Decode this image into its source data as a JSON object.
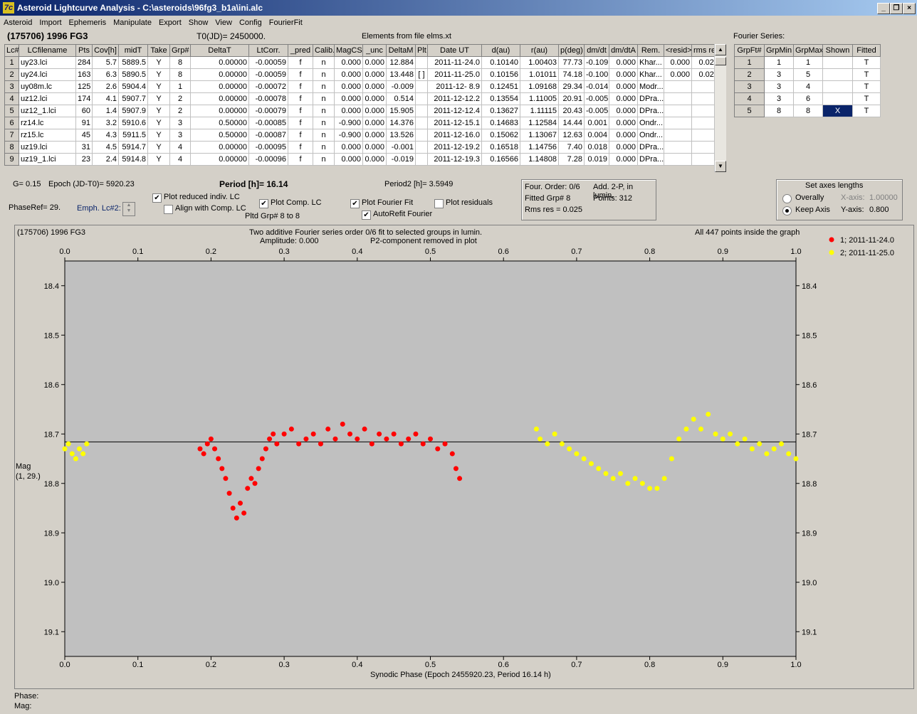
{
  "window": {
    "title": "Asteroid Lightcurve Analysis - C:\\asteroids\\96fg3_b1a\\ini.alc",
    "app_icon": "7c",
    "controls": [
      "_",
      "❐",
      "×"
    ]
  },
  "menu": [
    "Asteroid",
    "Import",
    "Ephemeris",
    "Manipulate",
    "Export",
    "Show",
    "View",
    "Config",
    "FourierFit"
  ],
  "header": {
    "asteroid": "(175706) 1996 FG3",
    "t0": "T0(JD)= 2450000.",
    "elements": "Elements from file elms.xt"
  },
  "lc_table": {
    "columns": [
      "Lc#",
      "LCfilename",
      "Pts",
      "Cov[h]",
      "midT",
      "Take",
      "Grp#",
      "DeltaT",
      "LtCorr.",
      "_pred",
      "Calib.",
      "MagCS",
      "_unc",
      "DeltaM",
      "Plt",
      "Date UT",
      "d(au)",
      "r(au)",
      "p(deg)",
      "dm/dt",
      "dm/dtA",
      "Rem.",
      "<resid>",
      "rms res"
    ],
    "rows": [
      [
        "1",
        "uy23.lci",
        "284",
        "5.7",
        "5889.5",
        "Y",
        "8",
        "0.00000",
        "-0.00059",
        "f",
        "n",
        "0.000",
        "0.000",
        "12.884",
        "",
        "2011-11-24.0",
        "0.10140",
        "1.00403",
        "77.73",
        "-0.109",
        "0.000",
        "Khar...",
        "0.000",
        "0.024"
      ],
      [
        "2",
        "uy24.lci",
        "163",
        "6.3",
        "5890.5",
        "Y",
        "8",
        "0.00000",
        "-0.00059",
        "f",
        "n",
        "0.000",
        "0.000",
        "13.448",
        "[ ]",
        "2011-11-25.0",
        "0.10156",
        "1.01011",
        "74.18",
        "-0.100",
        "0.000",
        "Khar...",
        "0.000",
        "0.026"
      ],
      [
        "3",
        "uy08m.lc",
        "125",
        "2.6",
        "5904.4",
        "Y",
        "1",
        "0.00000",
        "-0.00072",
        "f",
        "n",
        "0.000",
        "0.000",
        "-0.009",
        "",
        "2011-12- 8.9",
        "0.12451",
        "1.09168",
        "29.34",
        "-0.014",
        "0.000",
        "Modr...",
        "",
        ""
      ],
      [
        "4",
        "uz12.lci",
        "174",
        "4.1",
        "5907.7",
        "Y",
        "2",
        "0.00000",
        "-0.00078",
        "f",
        "n",
        "0.000",
        "0.000",
        "0.514",
        "",
        "2011-12-12.2",
        "0.13554",
        "1.11005",
        "20.91",
        "-0.005",
        "0.000",
        "DPra...",
        "",
        ""
      ],
      [
        "5",
        "uz12_1.lci",
        "60",
        "1.4",
        "5907.9",
        "Y",
        "2",
        "0.00000",
        "-0.00079",
        "f",
        "n",
        "0.000",
        "0.000",
        "15.905",
        "",
        "2011-12-12.4",
        "0.13627",
        "1.11115",
        "20.43",
        "-0.005",
        "0.000",
        "DPra...",
        "",
        ""
      ],
      [
        "6",
        "rz14.lc",
        "91",
        "3.2",
        "5910.6",
        "Y",
        "3",
        "0.50000",
        "-0.00085",
        "f",
        "n",
        "-0.900",
        "0.000",
        "14.376",
        "",
        "2011-12-15.1",
        "0.14683",
        "1.12584",
        "14.44",
        "0.001",
        "0.000",
        "Ondr...",
        "",
        ""
      ],
      [
        "7",
        "rz15.lc",
        "45",
        "4.3",
        "5911.5",
        "Y",
        "3",
        "0.50000",
        "-0.00087",
        "f",
        "n",
        "-0.900",
        "0.000",
        "13.526",
        "",
        "2011-12-16.0",
        "0.15062",
        "1.13067",
        "12.63",
        "0.004",
        "0.000",
        "Ondr...",
        "",
        ""
      ],
      [
        "8",
        "uz19.lci",
        "31",
        "4.5",
        "5914.7",
        "Y",
        "4",
        "0.00000",
        "-0.00095",
        "f",
        "n",
        "0.000",
        "0.000",
        "-0.001",
        "",
        "2011-12-19.2",
        "0.16518",
        "1.14756",
        "7.40",
        "0.018",
        "0.000",
        "DPra...",
        "",
        ""
      ],
      [
        "9",
        "uz19_1.lci",
        "23",
        "2.4",
        "5914.8",
        "Y",
        "4",
        "0.00000",
        "-0.00096",
        "f",
        "n",
        "0.000",
        "0.000",
        "-0.019",
        "",
        "2011-12-19.3",
        "0.16566",
        "1.14808",
        "7.28",
        "0.019",
        "0.000",
        "DPra...",
        "",
        ""
      ]
    ]
  },
  "fourier_series": {
    "label": "Fourier Series:",
    "columns": [
      "GrpFt#",
      "GrpMin",
      "GrpMax",
      "Shown",
      "Fitted"
    ],
    "rows": [
      [
        "1",
        "1",
        "1",
        "",
        "T"
      ],
      [
        "2",
        "3",
        "5",
        "",
        "T"
      ],
      [
        "3",
        "3",
        "4",
        "",
        "T"
      ],
      [
        "4",
        "3",
        "6",
        "",
        "T"
      ],
      [
        "5",
        "8",
        "8",
        "X",
        "T"
      ]
    ]
  },
  "controls": {
    "g": "G= 0.15",
    "epoch": "Epoch (JD-T0)= 5920.23",
    "period": "Period [h]= 16.14",
    "period2": "Period2 [h]= 3.5949",
    "phaseref": "PhaseRef= 29.",
    "emph": "Emph. Lc#2:",
    "plot_reduced": "Plot reduced indiv. LC",
    "align": "Align with Comp. LC",
    "plot_comp": "Plot Comp. LC",
    "pltd_grp": "Pltd Grp#  8   to   8",
    "plot_fourier": "Plot Fourier Fit",
    "autorefit": "AutoRefit Fourier",
    "plot_residuals": "Plot residuals",
    "check_states": {
      "plot_reduced": true,
      "align": false,
      "plot_comp": true,
      "plot_fourier": true,
      "autorefit": true,
      "plot_residuals": false
    }
  },
  "fit_info": {
    "four_order": "Four. Order:  0/6",
    "add": "Add. 2-P, in lumin.",
    "fitted_grp": "Fitted Grp# 8",
    "points": "Points: 312",
    "rms": "Rms res     = 0.025"
  },
  "axes_box": {
    "title": "Set axes lengths",
    "overally": "Overally",
    "keep_axis": "Keep Axis",
    "x_label": "X-axis:",
    "x_value": "1.00000",
    "y_label": "Y-axis:",
    "y_value": "0.800",
    "selected": "keep_axis"
  },
  "plot": {
    "name": "(175706) 1996 FG3",
    "title_line1": "Two additive Fourier series order 0/6 fit to selected groups in lumin.",
    "title_line2_left": "Amplitude: 0.000",
    "title_line2_right": "P2-component removed in plot",
    "points_note": "All 447 points inside the graph",
    "ylabel": "Mag",
    "ylabel2": "(1, 29.)",
    "xlabel": "Synodic Phase (Epoch 2455920.23, Period 16.14 h)"
  },
  "chart_data": {
    "type": "scatter",
    "x_range": [
      0.0,
      1.0
    ],
    "y_range": [
      18.35,
      19.15
    ],
    "y_inverted": true,
    "x_ticks": [
      0.0,
      0.1,
      0.2,
      0.3,
      0.4,
      0.5,
      0.6,
      0.7,
      0.8,
      0.9,
      1.0
    ],
    "y_ticks": [
      18.4,
      18.5,
      18.6,
      18.7,
      18.8,
      18.9,
      19.0,
      19.1
    ],
    "fit_line_mag": 18.716,
    "series": [
      {
        "name": "1; 2011-11-24.0",
        "color": "#ff0000",
        "points": [
          [
            0.185,
            18.73
          ],
          [
            0.19,
            18.74
          ],
          [
            0.195,
            18.72
          ],
          [
            0.2,
            18.71
          ],
          [
            0.205,
            18.73
          ],
          [
            0.21,
            18.75
          ],
          [
            0.215,
            18.77
          ],
          [
            0.22,
            18.79
          ],
          [
            0.225,
            18.82
          ],
          [
            0.23,
            18.85
          ],
          [
            0.235,
            18.87
          ],
          [
            0.24,
            18.84
          ],
          [
            0.245,
            18.86
          ],
          [
            0.25,
            18.81
          ],
          [
            0.255,
            18.79
          ],
          [
            0.26,
            18.8
          ],
          [
            0.265,
            18.77
          ],
          [
            0.27,
            18.75
          ],
          [
            0.275,
            18.73
          ],
          [
            0.28,
            18.71
          ],
          [
            0.285,
            18.7
          ],
          [
            0.29,
            18.72
          ],
          [
            0.3,
            18.7
          ],
          [
            0.31,
            18.69
          ],
          [
            0.32,
            18.72
          ],
          [
            0.33,
            18.71
          ],
          [
            0.34,
            18.7
          ],
          [
            0.35,
            18.72
          ],
          [
            0.36,
            18.69
          ],
          [
            0.37,
            18.71
          ],
          [
            0.38,
            18.68
          ],
          [
            0.39,
            18.7
          ],
          [
            0.4,
            18.71
          ],
          [
            0.41,
            18.69
          ],
          [
            0.42,
            18.72
          ],
          [
            0.43,
            18.7
          ],
          [
            0.44,
            18.71
          ],
          [
            0.45,
            18.7
          ],
          [
            0.46,
            18.72
          ],
          [
            0.47,
            18.71
          ],
          [
            0.48,
            18.7
          ],
          [
            0.49,
            18.72
          ],
          [
            0.5,
            18.71
          ],
          [
            0.51,
            18.73
          ],
          [
            0.52,
            18.72
          ],
          [
            0.53,
            18.74
          ],
          [
            0.535,
            18.77
          ],
          [
            0.54,
            18.79
          ]
        ]
      },
      {
        "name": "2; 2011-11-25.0",
        "color": "#ffff00",
        "points": [
          [
            0.0,
            18.73
          ],
          [
            0.005,
            18.72
          ],
          [
            0.01,
            18.74
          ],
          [
            0.015,
            18.75
          ],
          [
            0.02,
            18.73
          ],
          [
            0.025,
            18.74
          ],
          [
            0.03,
            18.72
          ],
          [
            0.645,
            18.69
          ],
          [
            0.65,
            18.71
          ],
          [
            0.66,
            18.72
          ],
          [
            0.67,
            18.7
          ],
          [
            0.68,
            18.72
          ],
          [
            0.69,
            18.73
          ],
          [
            0.7,
            18.74
          ],
          [
            0.71,
            18.75
          ],
          [
            0.72,
            18.76
          ],
          [
            0.73,
            18.77
          ],
          [
            0.74,
            18.78
          ],
          [
            0.75,
            18.79
          ],
          [
            0.76,
            18.78
          ],
          [
            0.77,
            18.8
          ],
          [
            0.78,
            18.79
          ],
          [
            0.79,
            18.8
          ],
          [
            0.8,
            18.81
          ],
          [
            0.81,
            18.81
          ],
          [
            0.82,
            18.79
          ],
          [
            0.83,
            18.75
          ],
          [
            0.84,
            18.71
          ],
          [
            0.85,
            18.69
          ],
          [
            0.86,
            18.67
          ],
          [
            0.87,
            18.69
          ],
          [
            0.88,
            18.66
          ],
          [
            0.89,
            18.7
          ],
          [
            0.9,
            18.71
          ],
          [
            0.91,
            18.7
          ],
          [
            0.92,
            18.72
          ],
          [
            0.93,
            18.71
          ],
          [
            0.94,
            18.73
          ],
          [
            0.95,
            18.72
          ],
          [
            0.96,
            18.74
          ],
          [
            0.97,
            18.73
          ],
          [
            0.98,
            18.72
          ],
          [
            0.99,
            18.74
          ],
          [
            1.0,
            18.75
          ]
        ]
      }
    ]
  },
  "status": {
    "phase": "Phase:",
    "mag": "Mag:"
  }
}
